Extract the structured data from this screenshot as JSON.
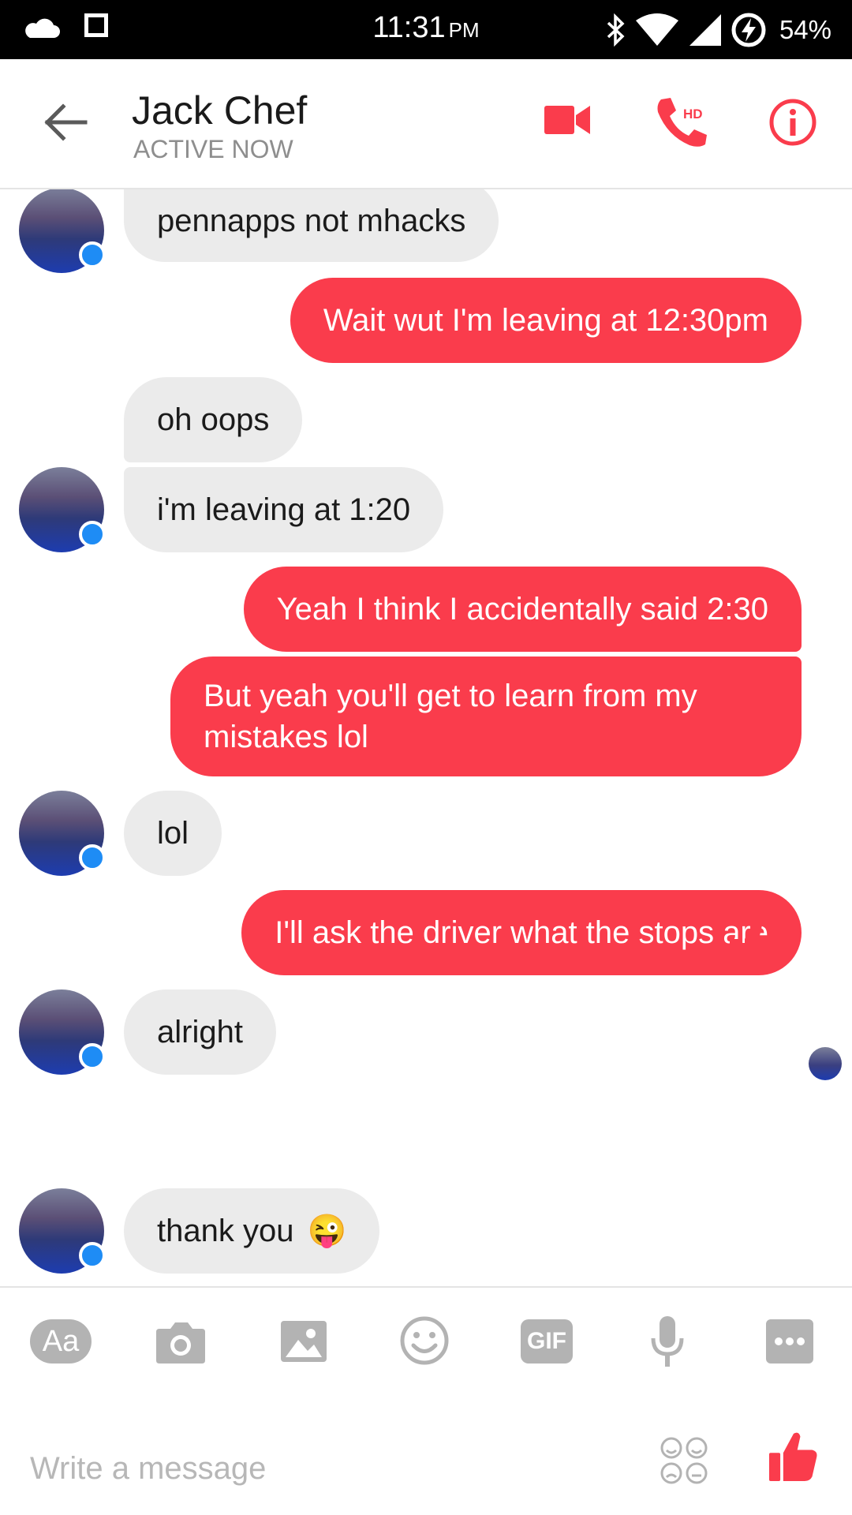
{
  "status_bar": {
    "time": "11:31",
    "ampm": "PM",
    "battery": "54%"
  },
  "header": {
    "contact_name": "Jack Chef",
    "contact_status": "ACTIVE NOW",
    "call_badge": "HD"
  },
  "messages": [
    {
      "from": "contact",
      "text": "pennapps not mhacks"
    },
    {
      "from": "me",
      "text": "Wait wut I'm leaving at 12:30pm"
    },
    {
      "from": "contact",
      "text": "oh oops"
    },
    {
      "from": "contact",
      "text": "i'm leaving at 1:20"
    },
    {
      "from": "me",
      "text": "Yeah I think I accidentally said 2:30"
    },
    {
      "from": "me",
      "text_line1": "But yeah you'll get to learn from my",
      "text_line2": "mistakes lol"
    },
    {
      "from": "contact",
      "text": "lol"
    },
    {
      "from": "me",
      "text": "I'll ask the driver what the stops are"
    },
    {
      "from": "contact",
      "text": "alright"
    },
    {
      "from": "me",
      "type": "like"
    },
    {
      "from": "contact",
      "text": "thank you",
      "emoji": "😜"
    }
  ],
  "toolbar": {
    "text_label": "Aa",
    "gif_label": "GIF"
  },
  "composer": {
    "placeholder": "Write a message"
  },
  "colors": {
    "accent": "#fa3c4c",
    "incoming": "#ebebeb",
    "messenger_badge": "#1e8cf5"
  }
}
